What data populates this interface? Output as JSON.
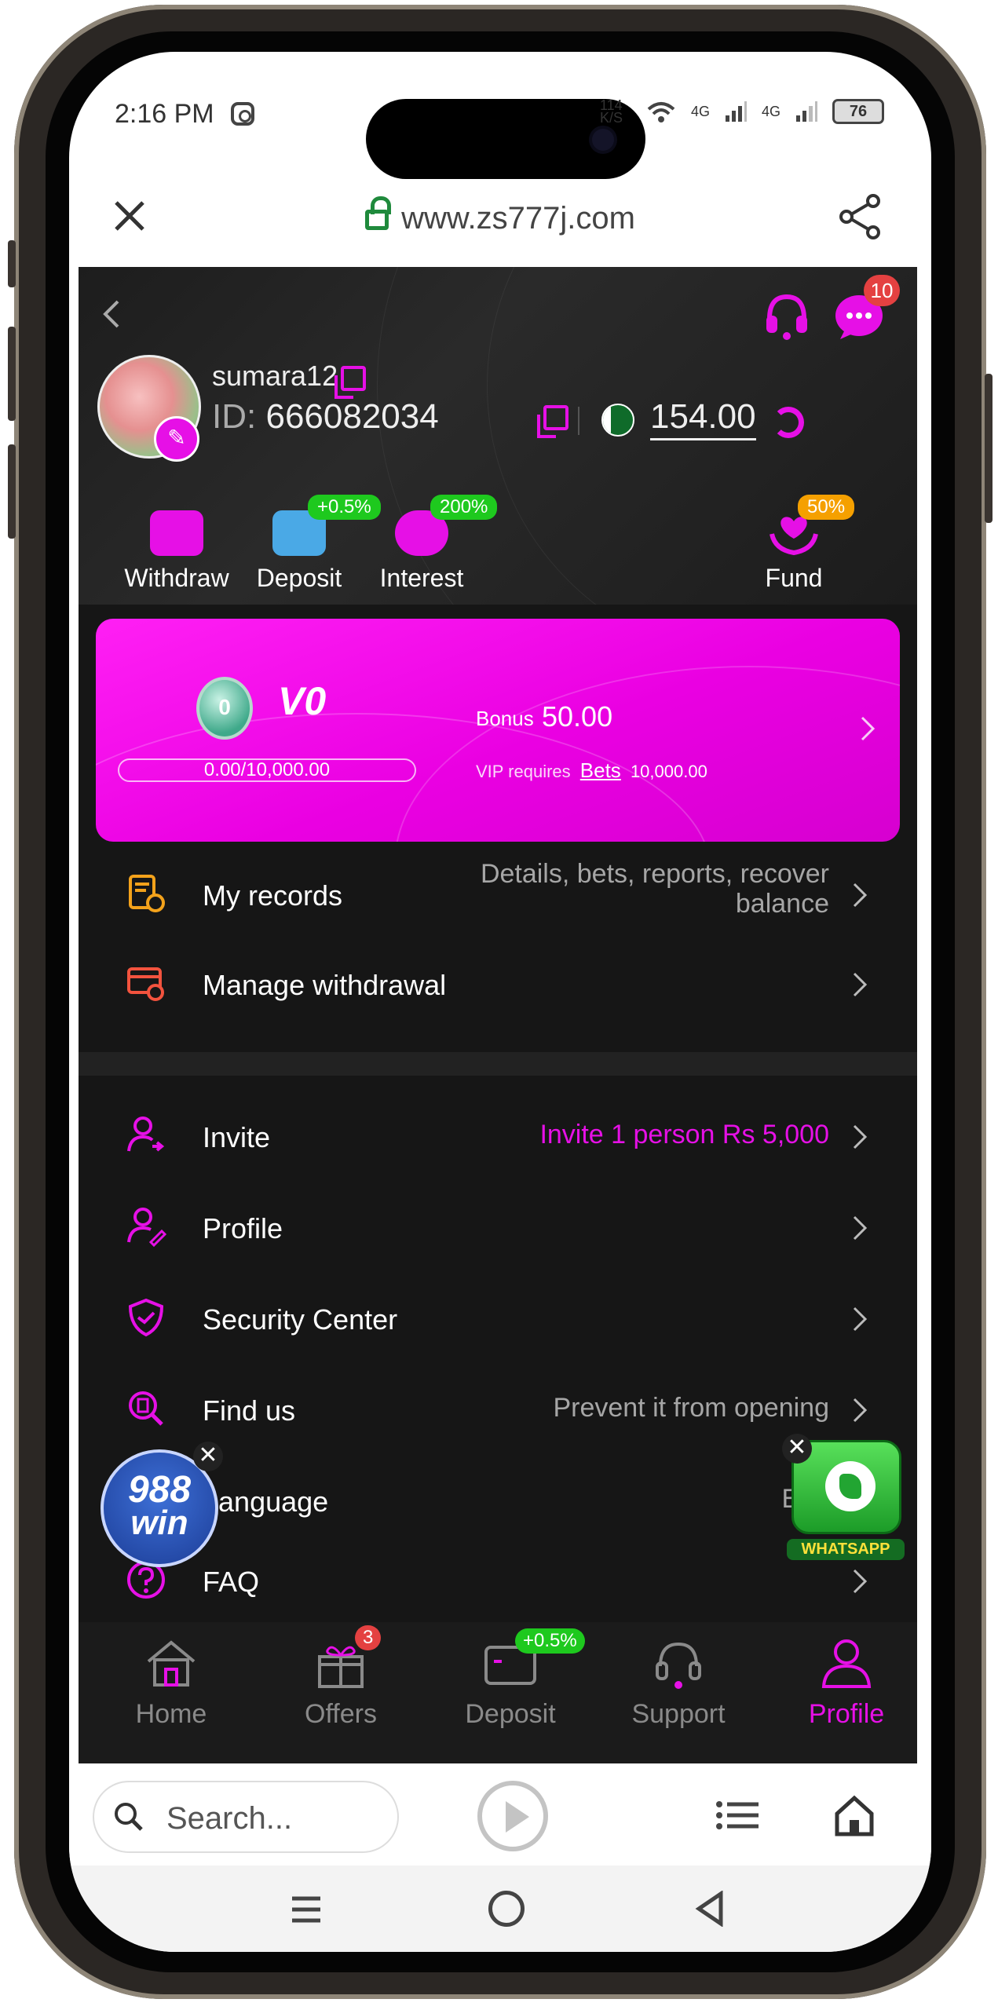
{
  "status_bar": {
    "time": "2:16 PM",
    "net_speed": "114 K/S",
    "signal1": "4G",
    "signal2": "4G",
    "battery": "76"
  },
  "browser": {
    "url": "www.zs777j.com",
    "search_placeholder": "Search..."
  },
  "header": {
    "msg_badge": "10",
    "username": "sumara12",
    "id_label": "ID:",
    "user_id": "666082034",
    "balance": "154.00"
  },
  "quick_actions": [
    {
      "label": "Withdraw",
      "badge": ""
    },
    {
      "label": "Deposit",
      "badge": "+0.5%"
    },
    {
      "label": "Interest",
      "badge": "200%"
    },
    {
      "label": "Fund",
      "badge": "50%"
    }
  ],
  "vip": {
    "medal": "0",
    "level": "V0",
    "progress": "0.00/10,000.00",
    "progress_fraction": 0,
    "bonus_label": "Bonus",
    "bonus_value": "50.00",
    "req_prefix": "VIP requires",
    "req_link": "Bets",
    "req_amount": "10,000.00"
  },
  "menu_top": [
    {
      "label": "My records",
      "right": "Details, bets, reports, recover",
      "right2": "balance"
    },
    {
      "label": "Manage withdrawal",
      "right": ""
    }
  ],
  "menu_bottom": [
    {
      "label": "Invite",
      "right": "Invite 1 person Rs 5,000"
    },
    {
      "label": "Profile",
      "right": ""
    },
    {
      "label": "Security Center",
      "right": ""
    },
    {
      "label": "Find us",
      "right": "Prevent it from opening"
    },
    {
      "label": "Language",
      "right": "Eng"
    },
    {
      "label": "FAQ",
      "right": ""
    }
  ],
  "bottom_nav": [
    {
      "label": "Home",
      "badge": ""
    },
    {
      "label": "Offers",
      "badge": "3"
    },
    {
      "label": "Deposit",
      "badge": "+0.5%"
    },
    {
      "label": "Support",
      "badge": ""
    },
    {
      "label": "Profile",
      "badge": ""
    }
  ],
  "floaters": {
    "logo_line1": "988",
    "logo_line2": "win",
    "close": "✕",
    "whatsapp": "WHATSAPP"
  },
  "colors": {
    "accent": "#e610e6",
    "bg": "#161616",
    "green_badge": "#1ec91e",
    "red_badge": "#e44141"
  }
}
